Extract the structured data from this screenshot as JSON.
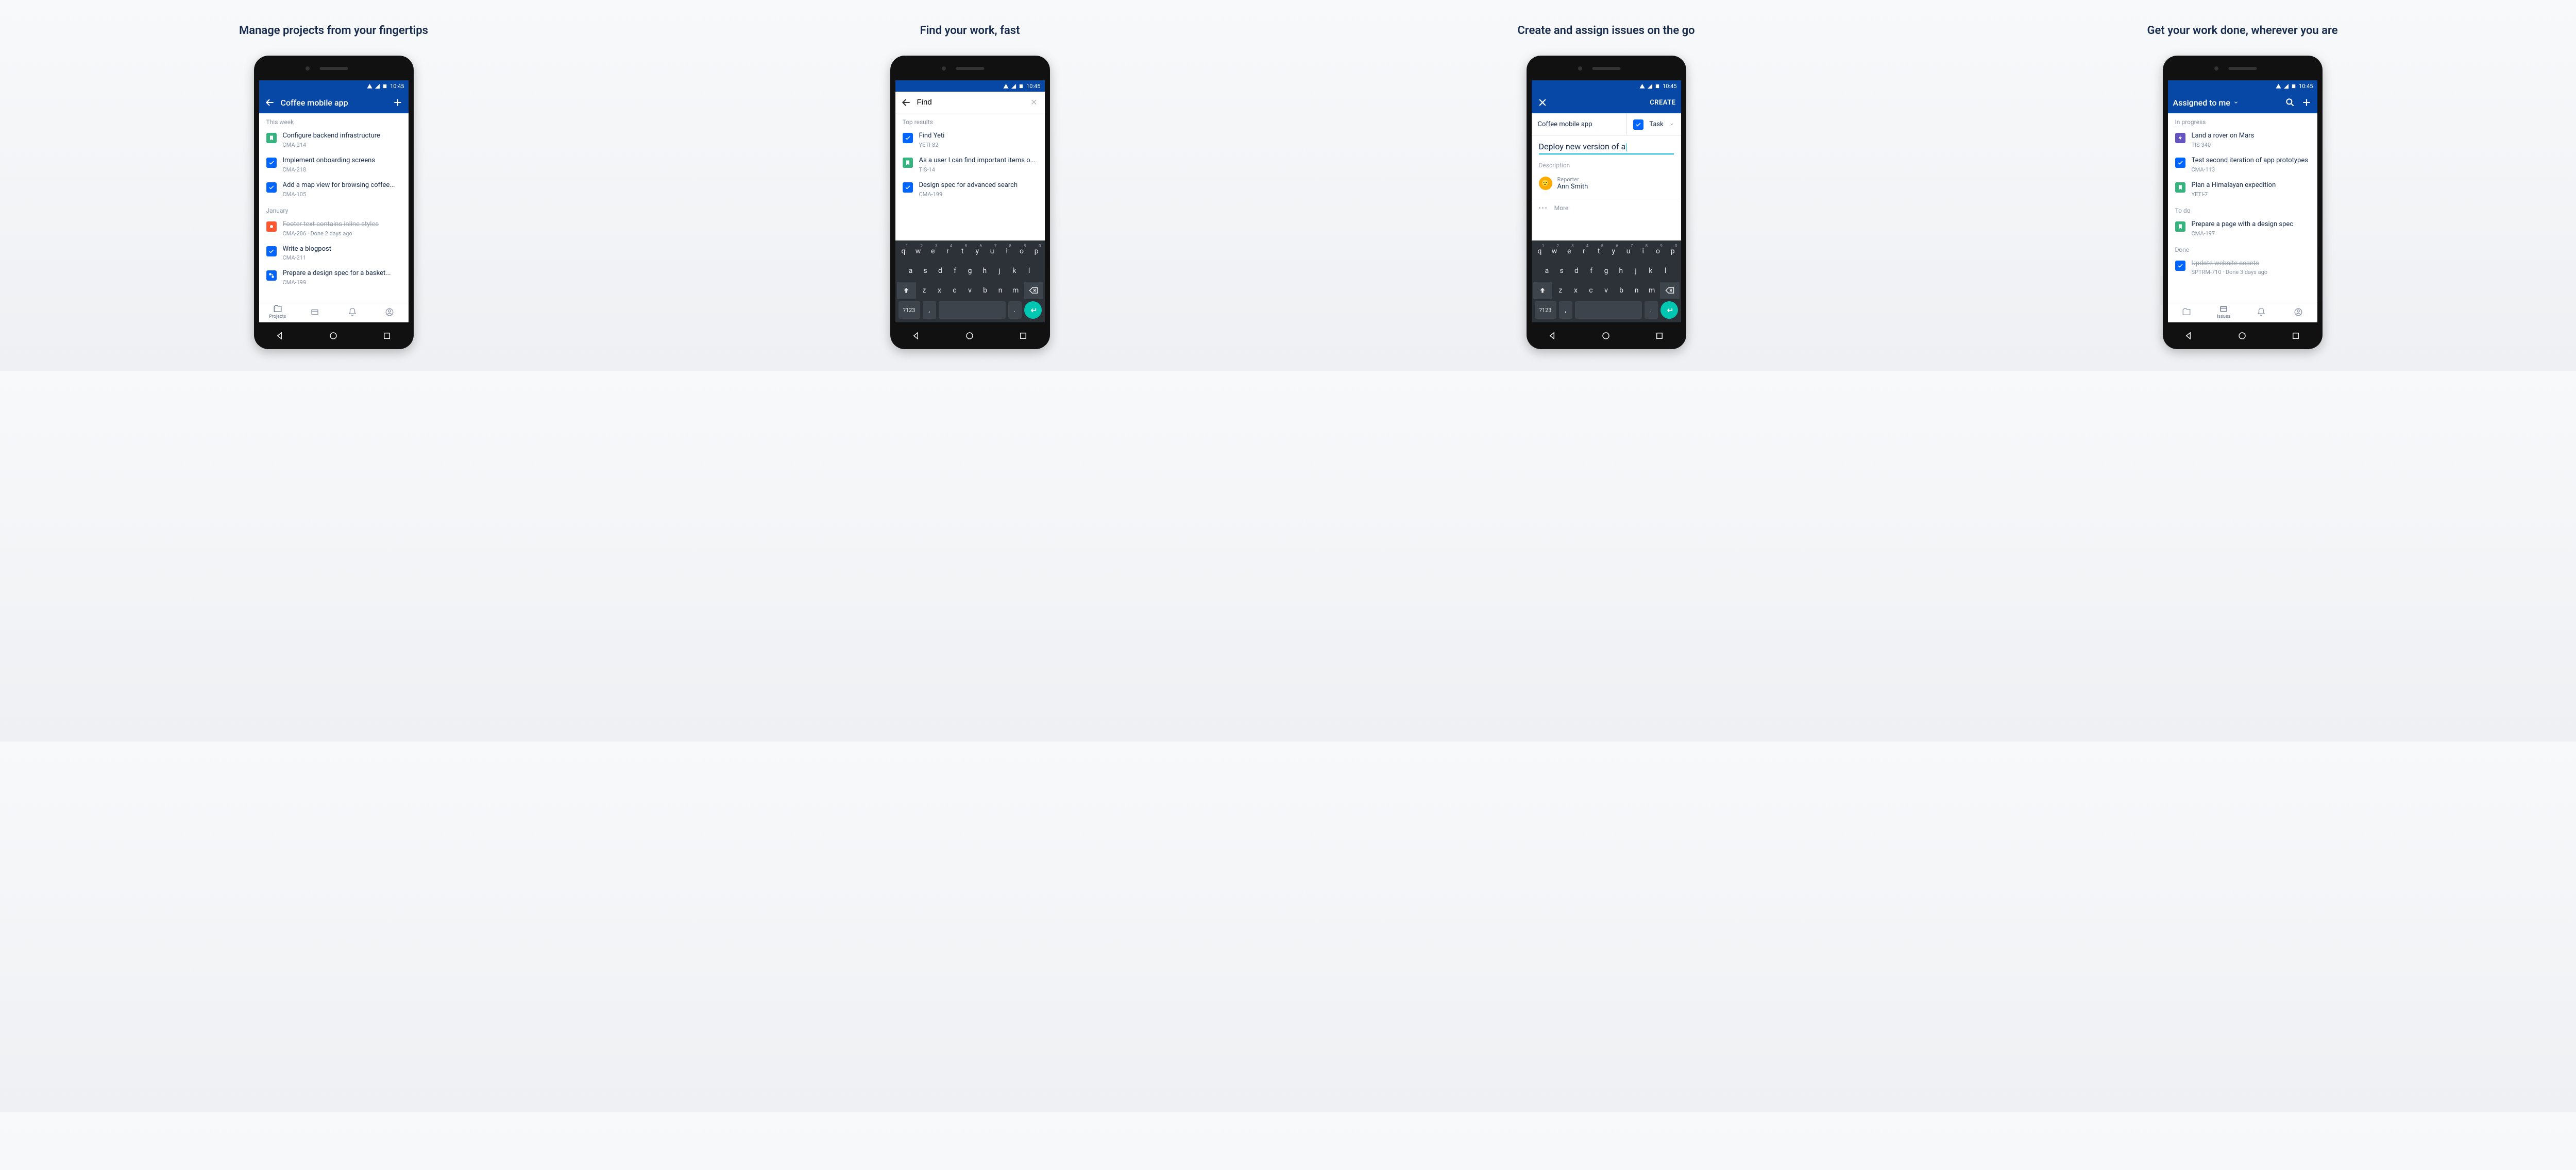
{
  "status_time": "10:45",
  "captions": [
    "Manage projects from your fingertips",
    "Find your work, fast",
    "Create and assign issues on the go",
    "Get your work done, wherever you are"
  ],
  "phone1": {
    "title": "Coffee mobile app",
    "sections": [
      {
        "label": "This week",
        "items": [
          {
            "type": "story",
            "title": "Configure backend infrastructure",
            "sub": "CMA-214"
          },
          {
            "type": "task",
            "title": "Implement onboarding screens",
            "sub": "CMA-218"
          },
          {
            "type": "task",
            "title": "Add a map view for browsing coffee...",
            "sub": "CMA-105"
          }
        ]
      },
      {
        "label": "January",
        "items": [
          {
            "type": "bug",
            "title": "Footer text contains inline styles",
            "sub": "CMA-206 · Done 2 days ago",
            "struck": true
          },
          {
            "type": "task",
            "title": "Write a blogpost",
            "sub": "CMA-211"
          },
          {
            "type": "subtask",
            "title": "Prepare a design spec for a basket...",
            "sub": "CMA-199"
          }
        ]
      }
    ],
    "bottomnav": {
      "projects": "Projects"
    }
  },
  "phone2": {
    "search_value": "Find",
    "top_label": "Top results",
    "results": [
      {
        "type": "task",
        "title": "Find Yeti",
        "sub": "YETI-82"
      },
      {
        "type": "story",
        "title": "As a user I can find important items o...",
        "sub": "TIS-14"
      },
      {
        "type": "task",
        "title": "Design spec for advanced search",
        "sub": "CMA-199"
      }
    ]
  },
  "phone3": {
    "action": "CREATE",
    "project": "Coffee mobile app",
    "issuetype": "Task",
    "summary": "Deploy new version of a",
    "desc_label": "Description",
    "reporter_label": "Reporter",
    "reporter_name": "Ann Smith",
    "more_label": "More"
  },
  "phone4": {
    "title": "Assigned to me",
    "sections": [
      {
        "label": "In progress",
        "items": [
          {
            "type": "epic",
            "title": "Land a rover on Mars",
            "sub": "TIS-340"
          },
          {
            "type": "task",
            "title": "Test second iteration of app prototypes",
            "sub": "CMA-113"
          },
          {
            "type": "story",
            "title": "Plan a Himalayan expedition",
            "sub": "YETI-7"
          }
        ]
      },
      {
        "label": "To do",
        "items": [
          {
            "type": "story",
            "title": "Prepare a page with a design spec",
            "sub": "CMA-197"
          }
        ]
      },
      {
        "label": "Done",
        "items": [
          {
            "type": "task",
            "title": "Update website assets",
            "sub": "SPTRM-710 · Done 3 days ago",
            "struck": true
          }
        ]
      }
    ],
    "bottomnav": {
      "issues": "Issues"
    }
  },
  "keyboard": {
    "row1": [
      {
        "k": "q",
        "n": "1"
      },
      {
        "k": "w",
        "n": "2"
      },
      {
        "k": "e",
        "n": "3"
      },
      {
        "k": "r",
        "n": "4"
      },
      {
        "k": "t",
        "n": "5"
      },
      {
        "k": "y",
        "n": "6"
      },
      {
        "k": "u",
        "n": "7"
      },
      {
        "k": "i",
        "n": "8"
      },
      {
        "k": "o",
        "n": "9"
      },
      {
        "k": "p",
        "n": "0"
      }
    ],
    "row2": [
      "a",
      "s",
      "d",
      "f",
      "g",
      "h",
      "j",
      "k",
      "l"
    ],
    "row3": [
      "z",
      "x",
      "c",
      "v",
      "b",
      "n",
      "m"
    ],
    "symkey": "?123",
    "comma": ",",
    "period": "."
  }
}
